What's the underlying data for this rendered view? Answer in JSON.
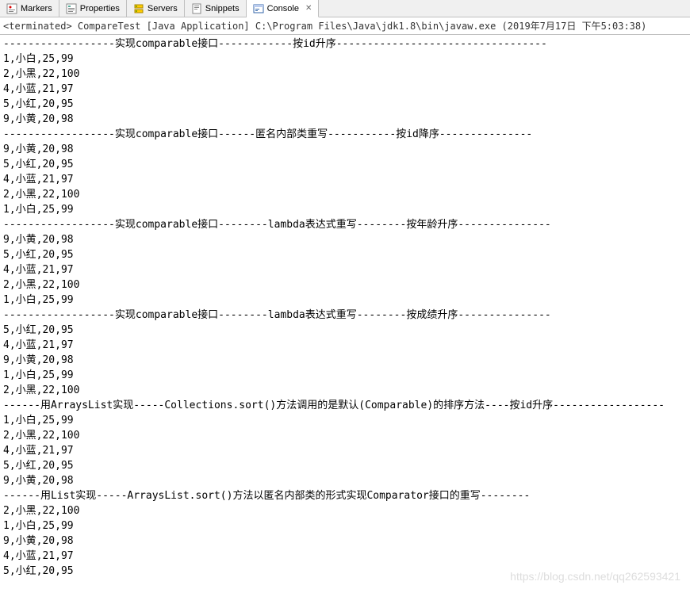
{
  "tabs": [
    {
      "label": "Markers",
      "icon": "markers"
    },
    {
      "label": "Properties",
      "icon": "properties"
    },
    {
      "label": "Servers",
      "icon": "servers"
    },
    {
      "label": "Snippets",
      "icon": "snippets"
    },
    {
      "label": "Console",
      "icon": "console",
      "active": true,
      "closable": true
    }
  ],
  "terminated": "<terminated> CompareTest [Java Application] C:\\Program Files\\Java\\jdk1.8\\bin\\javaw.exe (2019年7月17日 下午5:03:38)",
  "output": [
    "------------------实现comparable接口------------按id升序----------------------------------",
    "1,小白,25,99",
    "2,小黑,22,100",
    "4,小蓝,21,97",
    "5,小红,20,95",
    "9,小黄,20,98",
    "------------------实现comparable接口------匿名内部类重写-----------按id降序---------------",
    "9,小黄,20,98",
    "5,小红,20,95",
    "4,小蓝,21,97",
    "2,小黑,22,100",
    "1,小白,25,99",
    "------------------实现comparable接口--------lambda表达式重写--------按年龄升序---------------",
    "9,小黄,20,98",
    "5,小红,20,95",
    "4,小蓝,21,97",
    "2,小黑,22,100",
    "1,小白,25,99",
    "------------------实现comparable接口--------lambda表达式重写--------按成绩升序---------------",
    "5,小红,20,95",
    "4,小蓝,21,97",
    "9,小黄,20,98",
    "1,小白,25,99",
    "2,小黑,22,100",
    "------用ArraysList实现-----Collections.sort()方法调用的是默认(Comparable)的排序方法----按id升序------------------",
    "1,小白,25,99",
    "2,小黑,22,100",
    "4,小蓝,21,97",
    "5,小红,20,95",
    "9,小黄,20,98",
    "------用List实现-----ArraysList.sort()方法以匿名内部类的形式实现Comparator接口的重写--------",
    "2,小黑,22,100",
    "1,小白,25,99",
    "9,小黄,20,98",
    "4,小蓝,21,97",
    "5,小红,20,95"
  ],
  "watermark": "https://blog.csdn.net/qq262593421"
}
